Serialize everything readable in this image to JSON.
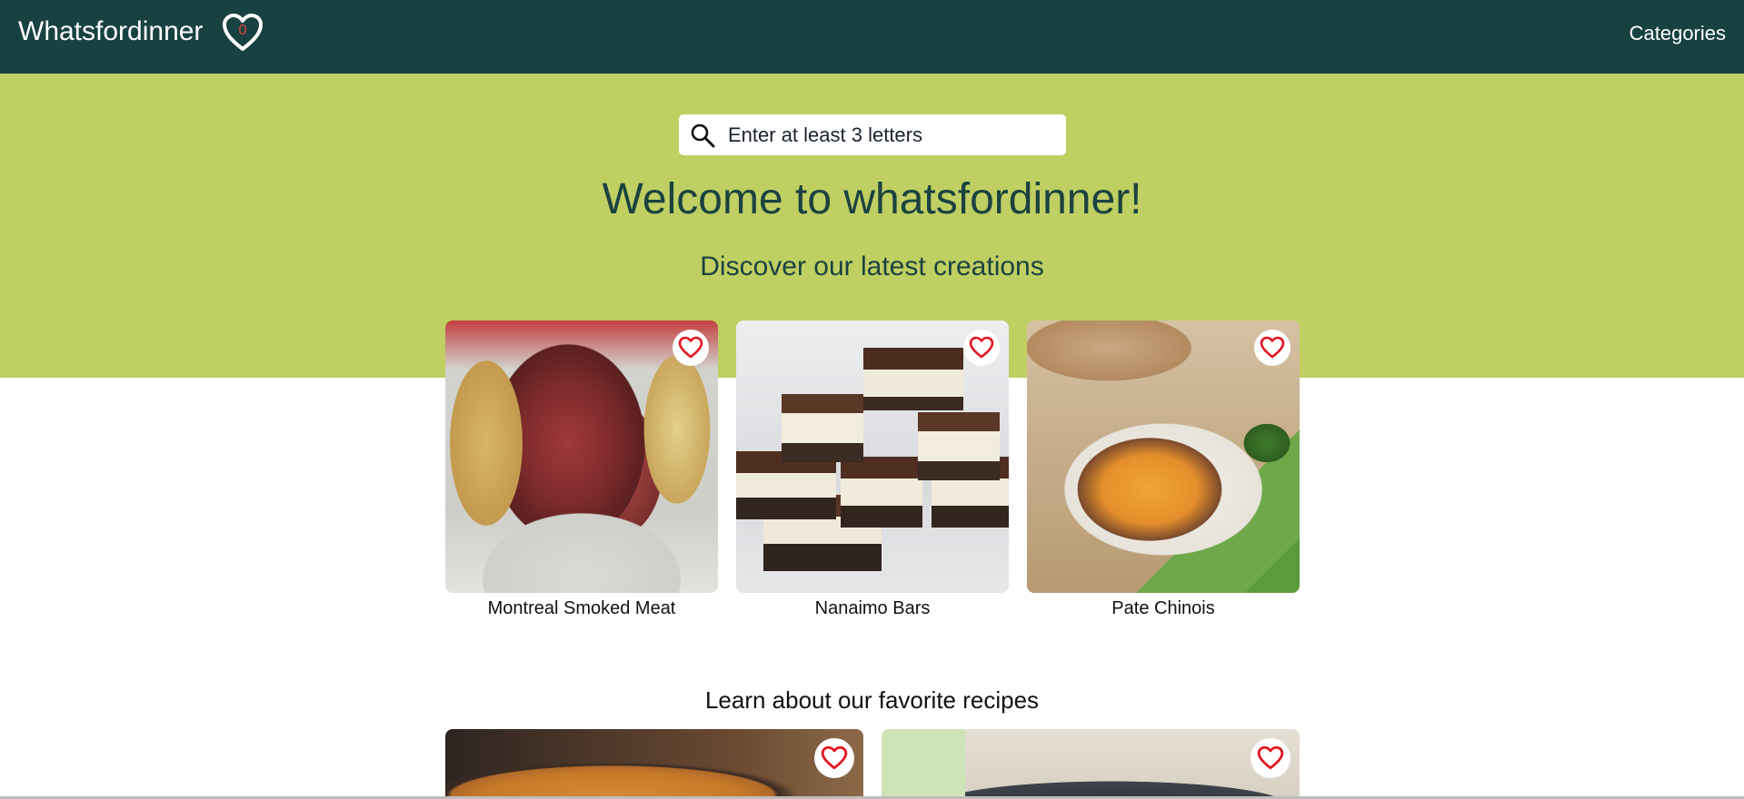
{
  "nav": {
    "brand": "Whatsfordinner",
    "favorites_count": "0",
    "categories_label": "Categories"
  },
  "hero": {
    "search_placeholder": "Enter at least 3 letters",
    "title": "Welcome to whatsfordinner!",
    "subtitle": "Discover our latest creations"
  },
  "latest": [
    {
      "name": "Montreal Smoked Meat",
      "icon": "heart-outline-icon"
    },
    {
      "name": "Nanaimo Bars",
      "icon": "heart-outline-icon"
    },
    {
      "name": "Pate Chinois",
      "icon": "heart-outline-icon"
    }
  ],
  "favorites_section": {
    "title": "Learn about our favorite recipes"
  },
  "colors": {
    "navbar": "#184241",
    "hero": "#bfcf62",
    "heading": "#1c4240",
    "heart": "#e2141f"
  }
}
